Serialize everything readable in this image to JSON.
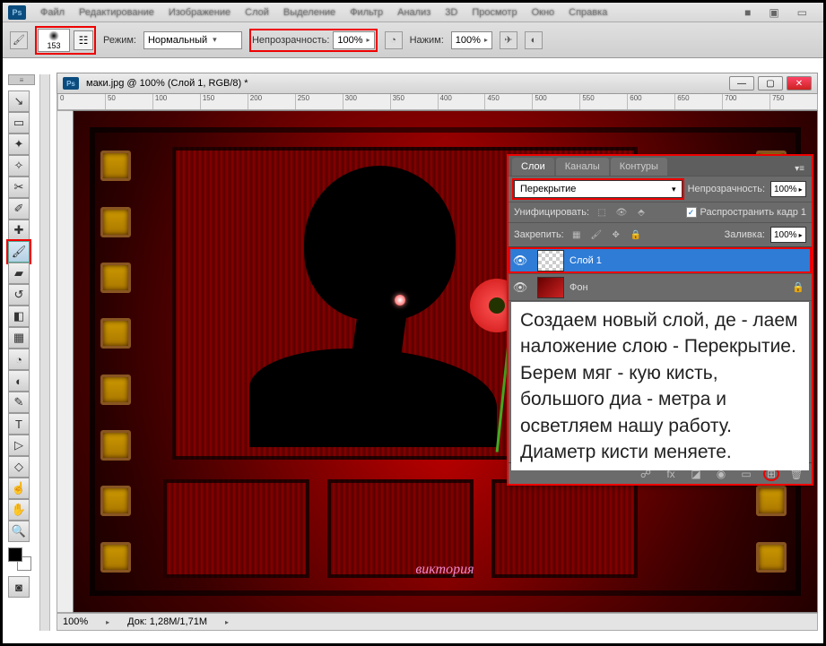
{
  "menubar": {
    "items": [
      "Файл",
      "Редактирование",
      "Изображение",
      "Слой",
      "Выделение",
      "Фильтр",
      "Анализ",
      "3D",
      "Просмотр",
      "Окно",
      "Справка"
    ],
    "end_icons": [
      "■",
      "▣",
      "▭"
    ]
  },
  "optbar": {
    "brush_size": "153",
    "mode_label": "Режим:",
    "mode_value": "Нормальный",
    "opacity_label": "Непрозрачность:",
    "opacity_value": "100%",
    "flow_label": "Нажим:",
    "flow_value": "100%"
  },
  "tools": [
    {
      "icon": "↘",
      "name": "move-tool"
    },
    {
      "icon": "▭",
      "name": "marquee-tool"
    },
    {
      "icon": "✦",
      "name": "lasso-tool"
    },
    {
      "icon": "✧",
      "name": "wand-tool"
    },
    {
      "icon": "✂",
      "name": "crop-tool"
    },
    {
      "icon": "✐",
      "name": "eyedropper-tool"
    },
    {
      "icon": "✚",
      "name": "heal-tool"
    },
    {
      "icon": "🖌",
      "name": "brush-tool",
      "active": true,
      "hl": true
    },
    {
      "icon": "▰",
      "name": "stamp-tool"
    },
    {
      "icon": "↺",
      "name": "history-brush-tool"
    },
    {
      "icon": "◧",
      "name": "eraser-tool"
    },
    {
      "icon": "▦",
      "name": "gradient-tool"
    },
    {
      "icon": "◔",
      "name": "blur-tool"
    },
    {
      "icon": "◐",
      "name": "dodge-tool"
    },
    {
      "icon": "✎",
      "name": "pen-tool"
    },
    {
      "icon": "T",
      "name": "type-tool"
    },
    {
      "icon": "▷",
      "name": "path-tool"
    },
    {
      "icon": "◇",
      "name": "shape-tool"
    },
    {
      "icon": "☝",
      "name": "3d-tool"
    },
    {
      "icon": "✋",
      "name": "hand-tool"
    },
    {
      "icon": "🔍",
      "name": "zoom-tool"
    }
  ],
  "doc": {
    "title": "маки.jpg @ 100% (Слой 1, RGB/8) *",
    "ruler_marks": [
      "0",
      "50",
      "100",
      "150",
      "200",
      "250",
      "300",
      "350",
      "400",
      "450",
      "500",
      "550",
      "600",
      "650",
      "700",
      "750"
    ],
    "signature": "виктория"
  },
  "status": {
    "zoom": "100%",
    "doc_size_label": "Док:",
    "doc_size": "1,28M/1,71M"
  },
  "panel": {
    "tabs": [
      "Слои",
      "Каналы",
      "Контуры"
    ],
    "blend_mode": "Перекрытие",
    "opacity_label": "Непрозрачность:",
    "opacity_value": "100%",
    "unify_label": "Унифицировать:",
    "propagate_label": "Распространить кадр 1",
    "lock_label": "Закрепить:",
    "fill_label": "Заливка:",
    "fill_value": "100%",
    "layers": [
      {
        "name": "Слой 1",
        "active": true
      },
      {
        "name": "Фон",
        "locked": true
      }
    ],
    "foot_icons": [
      "☍",
      "fx",
      "◪",
      "◉",
      "▭",
      "⊞",
      "🗑"
    ]
  },
  "annotation": {
    "text": "Создаем новый слой, де - лаем наложение слою - Перекрытие. Берем мяг - кую кисть, большого диа - метра и осветляем нашу работу. Диаметр кисти меняете."
  }
}
